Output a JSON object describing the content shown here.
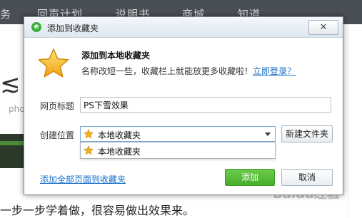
{
  "background": {
    "nav_items": [
      "务",
      "回声计划",
      "说明书",
      "商城",
      "知道"
    ],
    "big_text": "≲ [1",
    "small_text": "pho",
    "bottom_text": "一步一步学着做，很容易做出效果来。",
    "watermark": "Baidu经验"
  },
  "dialog": {
    "title": "添加到收藏夹",
    "close_label": "✕",
    "heading": "添加到本地收藏夹",
    "subtext": "名称改短一些，收藏栏上就能放更多收藏啦！",
    "login_link": "立即登录？",
    "page_title_label": "网页标题",
    "page_title_value": "PS下雪效果",
    "location_label": "创建位置",
    "location_selected": "本地收藏夹",
    "location_options": [
      "本地收藏夹"
    ],
    "new_folder_label": "新建文件夹",
    "add_all_link": "添加全部页面到收藏夹",
    "add_label": "添加",
    "cancel_label": "取消"
  },
  "colors": {
    "accent_green": "#48ad2c",
    "link_blue": "#1a6fc9",
    "star_gold": "#f3b21b"
  },
  "icons": {
    "app": "browser-logo-icon",
    "star": "star-icon",
    "dropdown": "chevron-down-icon",
    "close": "close-icon"
  }
}
